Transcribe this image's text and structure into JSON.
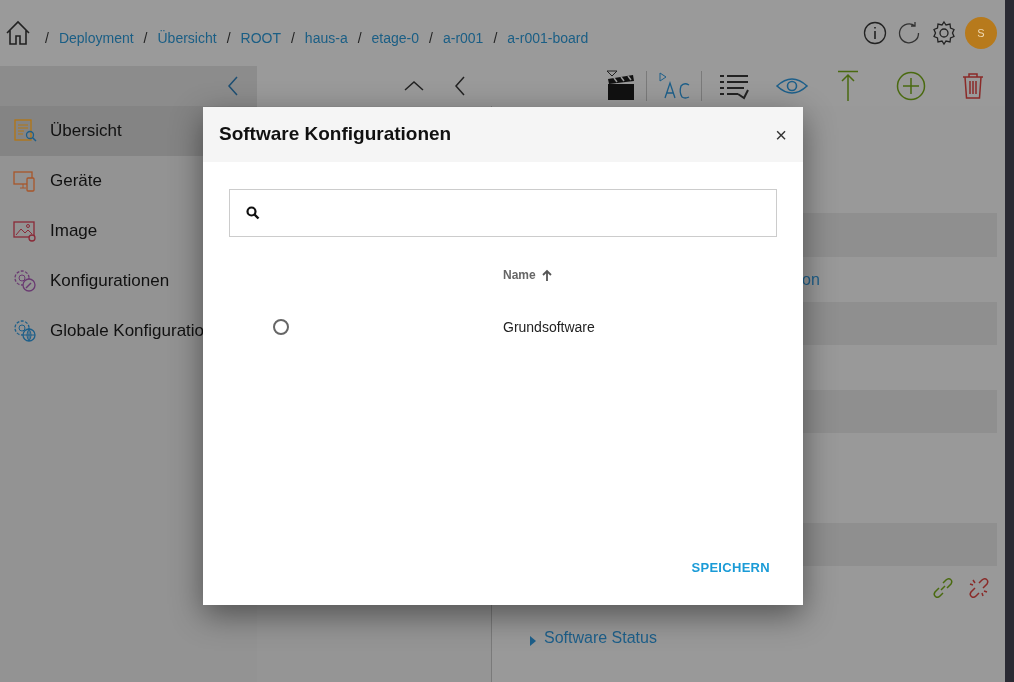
{
  "breadcrumb_separator": "/",
  "breadcrumb": [
    "Deployment",
    "Übersicht",
    "ROOT",
    "haus-a",
    "etage-0",
    "a-r001",
    "a-r001-board"
  ],
  "user": {
    "initial": "S"
  },
  "sidebar": {
    "items": [
      {
        "label": "Übersicht",
        "kind": "overview",
        "selected": true
      },
      {
        "label": "Geräte",
        "kind": "devices",
        "selected": false
      },
      {
        "label": "Image",
        "kind": "image",
        "selected": false
      },
      {
        "label": "Konfigurationen",
        "kind": "config",
        "selected": false
      },
      {
        "label": "Globale Konfiguratio",
        "kind": "global",
        "selected": false
      }
    ]
  },
  "background": {
    "partial_link": "on",
    "section": "Software Status",
    "section_expanded": false
  },
  "modal": {
    "title": "Software Konfigurationen",
    "close": "×",
    "columns": [
      {
        "label": "Name",
        "sorted_ascending": true
      }
    ],
    "rows": [
      {
        "name": "Grundsoftware",
        "selected": false
      }
    ],
    "save_button": "SPEICHERN"
  }
}
